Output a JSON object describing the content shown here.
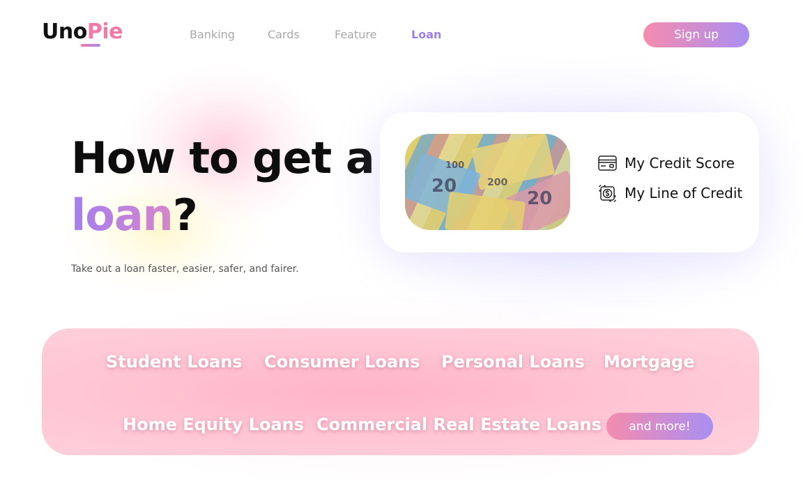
{
  "brand": {
    "part1": "Uno",
    "part2": "Pie"
  },
  "nav": {
    "items": [
      {
        "label": "Banking",
        "active": false
      },
      {
        "label": "Cards",
        "active": false
      },
      {
        "label": "Feature",
        "active": false
      },
      {
        "label": "Loan",
        "active": true
      }
    ],
    "signup_label": "Sign up"
  },
  "hero": {
    "title_line1": "How to get a",
    "title_accent": "loan",
    "title_end": "?",
    "subtitle": "Take out a loan faster, easier, safer, and fairer."
  },
  "credit_card": {
    "image_icon": "euro-banknotes-photo",
    "links": [
      {
        "label": "My Credit Score",
        "icon": "credit-card-icon"
      },
      {
        "label": "My Line of Credit",
        "icon": "dollar-cycle-icon"
      }
    ]
  },
  "loans": {
    "items": [
      "Student Loans",
      "Consumer Loans",
      "Personal Loans",
      "Mortgage",
      "Home Equity Loans",
      "Commercial Real Estate Loans"
    ],
    "more_label": "and more!"
  },
  "colors": {
    "accent_pink": "#f07aa8",
    "accent_purple": "#9b7ef0",
    "panel_pink": "#ffc4d3"
  }
}
